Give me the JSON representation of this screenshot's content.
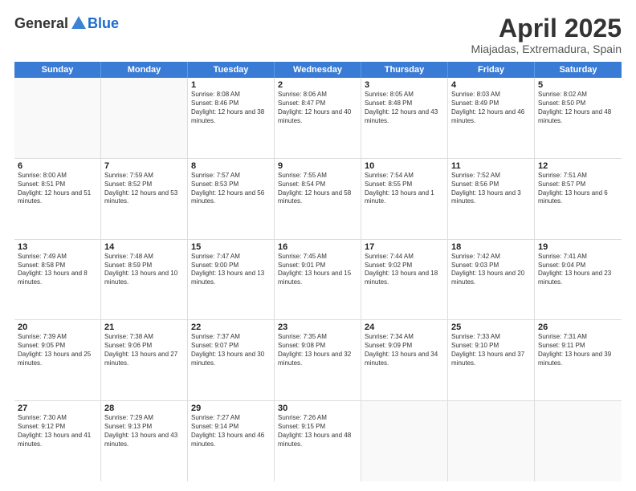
{
  "header": {
    "logo_general": "General",
    "logo_blue": "Blue",
    "title": "April 2025",
    "subtitle": "Miajadas, Extremadura, Spain"
  },
  "days_of_week": [
    "Sunday",
    "Monday",
    "Tuesday",
    "Wednesday",
    "Thursday",
    "Friday",
    "Saturday"
  ],
  "weeks": [
    [
      {
        "day": "",
        "sunrise": "",
        "sunset": "",
        "daylight": "",
        "empty": true
      },
      {
        "day": "",
        "sunrise": "",
        "sunset": "",
        "daylight": "",
        "empty": true
      },
      {
        "day": "1",
        "sunrise": "Sunrise: 8:08 AM",
        "sunset": "Sunset: 8:46 PM",
        "daylight": "Daylight: 12 hours and 38 minutes.",
        "empty": false
      },
      {
        "day": "2",
        "sunrise": "Sunrise: 8:06 AM",
        "sunset": "Sunset: 8:47 PM",
        "daylight": "Daylight: 12 hours and 40 minutes.",
        "empty": false
      },
      {
        "day": "3",
        "sunrise": "Sunrise: 8:05 AM",
        "sunset": "Sunset: 8:48 PM",
        "daylight": "Daylight: 12 hours and 43 minutes.",
        "empty": false
      },
      {
        "day": "4",
        "sunrise": "Sunrise: 8:03 AM",
        "sunset": "Sunset: 8:49 PM",
        "daylight": "Daylight: 12 hours and 46 minutes.",
        "empty": false
      },
      {
        "day": "5",
        "sunrise": "Sunrise: 8:02 AM",
        "sunset": "Sunset: 8:50 PM",
        "daylight": "Daylight: 12 hours and 48 minutes.",
        "empty": false
      }
    ],
    [
      {
        "day": "6",
        "sunrise": "Sunrise: 8:00 AM",
        "sunset": "Sunset: 8:51 PM",
        "daylight": "Daylight: 12 hours and 51 minutes.",
        "empty": false
      },
      {
        "day": "7",
        "sunrise": "Sunrise: 7:59 AM",
        "sunset": "Sunset: 8:52 PM",
        "daylight": "Daylight: 12 hours and 53 minutes.",
        "empty": false
      },
      {
        "day": "8",
        "sunrise": "Sunrise: 7:57 AM",
        "sunset": "Sunset: 8:53 PM",
        "daylight": "Daylight: 12 hours and 56 minutes.",
        "empty": false
      },
      {
        "day": "9",
        "sunrise": "Sunrise: 7:55 AM",
        "sunset": "Sunset: 8:54 PM",
        "daylight": "Daylight: 12 hours and 58 minutes.",
        "empty": false
      },
      {
        "day": "10",
        "sunrise": "Sunrise: 7:54 AM",
        "sunset": "Sunset: 8:55 PM",
        "daylight": "Daylight: 13 hours and 1 minute.",
        "empty": false
      },
      {
        "day": "11",
        "sunrise": "Sunrise: 7:52 AM",
        "sunset": "Sunset: 8:56 PM",
        "daylight": "Daylight: 13 hours and 3 minutes.",
        "empty": false
      },
      {
        "day": "12",
        "sunrise": "Sunrise: 7:51 AM",
        "sunset": "Sunset: 8:57 PM",
        "daylight": "Daylight: 13 hours and 6 minutes.",
        "empty": false
      }
    ],
    [
      {
        "day": "13",
        "sunrise": "Sunrise: 7:49 AM",
        "sunset": "Sunset: 8:58 PM",
        "daylight": "Daylight: 13 hours and 8 minutes.",
        "empty": false
      },
      {
        "day": "14",
        "sunrise": "Sunrise: 7:48 AM",
        "sunset": "Sunset: 8:59 PM",
        "daylight": "Daylight: 13 hours and 10 minutes.",
        "empty": false
      },
      {
        "day": "15",
        "sunrise": "Sunrise: 7:47 AM",
        "sunset": "Sunset: 9:00 PM",
        "daylight": "Daylight: 13 hours and 13 minutes.",
        "empty": false
      },
      {
        "day": "16",
        "sunrise": "Sunrise: 7:45 AM",
        "sunset": "Sunset: 9:01 PM",
        "daylight": "Daylight: 13 hours and 15 minutes.",
        "empty": false
      },
      {
        "day": "17",
        "sunrise": "Sunrise: 7:44 AM",
        "sunset": "Sunset: 9:02 PM",
        "daylight": "Daylight: 13 hours and 18 minutes.",
        "empty": false
      },
      {
        "day": "18",
        "sunrise": "Sunrise: 7:42 AM",
        "sunset": "Sunset: 9:03 PM",
        "daylight": "Daylight: 13 hours and 20 minutes.",
        "empty": false
      },
      {
        "day": "19",
        "sunrise": "Sunrise: 7:41 AM",
        "sunset": "Sunset: 9:04 PM",
        "daylight": "Daylight: 13 hours and 23 minutes.",
        "empty": false
      }
    ],
    [
      {
        "day": "20",
        "sunrise": "Sunrise: 7:39 AM",
        "sunset": "Sunset: 9:05 PM",
        "daylight": "Daylight: 13 hours and 25 minutes.",
        "empty": false
      },
      {
        "day": "21",
        "sunrise": "Sunrise: 7:38 AM",
        "sunset": "Sunset: 9:06 PM",
        "daylight": "Daylight: 13 hours and 27 minutes.",
        "empty": false
      },
      {
        "day": "22",
        "sunrise": "Sunrise: 7:37 AM",
        "sunset": "Sunset: 9:07 PM",
        "daylight": "Daylight: 13 hours and 30 minutes.",
        "empty": false
      },
      {
        "day": "23",
        "sunrise": "Sunrise: 7:35 AM",
        "sunset": "Sunset: 9:08 PM",
        "daylight": "Daylight: 13 hours and 32 minutes.",
        "empty": false
      },
      {
        "day": "24",
        "sunrise": "Sunrise: 7:34 AM",
        "sunset": "Sunset: 9:09 PM",
        "daylight": "Daylight: 13 hours and 34 minutes.",
        "empty": false
      },
      {
        "day": "25",
        "sunrise": "Sunrise: 7:33 AM",
        "sunset": "Sunset: 9:10 PM",
        "daylight": "Daylight: 13 hours and 37 minutes.",
        "empty": false
      },
      {
        "day": "26",
        "sunrise": "Sunrise: 7:31 AM",
        "sunset": "Sunset: 9:11 PM",
        "daylight": "Daylight: 13 hours and 39 minutes.",
        "empty": false
      }
    ],
    [
      {
        "day": "27",
        "sunrise": "Sunrise: 7:30 AM",
        "sunset": "Sunset: 9:12 PM",
        "daylight": "Daylight: 13 hours and 41 minutes.",
        "empty": false
      },
      {
        "day": "28",
        "sunrise": "Sunrise: 7:29 AM",
        "sunset": "Sunset: 9:13 PM",
        "daylight": "Daylight: 13 hours and 43 minutes.",
        "empty": false
      },
      {
        "day": "29",
        "sunrise": "Sunrise: 7:27 AM",
        "sunset": "Sunset: 9:14 PM",
        "daylight": "Daylight: 13 hours and 46 minutes.",
        "empty": false
      },
      {
        "day": "30",
        "sunrise": "Sunrise: 7:26 AM",
        "sunset": "Sunset: 9:15 PM",
        "daylight": "Daylight: 13 hours and 48 minutes.",
        "empty": false
      },
      {
        "day": "",
        "sunrise": "",
        "sunset": "",
        "daylight": "",
        "empty": true
      },
      {
        "day": "",
        "sunrise": "",
        "sunset": "",
        "daylight": "",
        "empty": true
      },
      {
        "day": "",
        "sunrise": "",
        "sunset": "",
        "daylight": "",
        "empty": true
      }
    ]
  ]
}
